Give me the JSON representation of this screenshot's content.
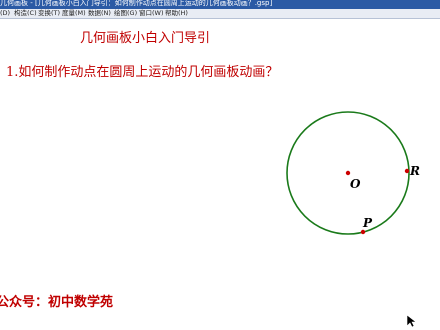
{
  "window": {
    "title": "几何画板 - [几何画板小白入门导引：如何制作动点在圆周上运动的几何画板动画？.gsp]"
  },
  "menu": {
    "items": [
      "(D)",
      "构造(C)",
      "变换(T)",
      "度量(M)",
      "数据(N)",
      "绘图(G)",
      "窗口(W)",
      "帮助(H)"
    ]
  },
  "canvas": {
    "heading": "几何画板小白入门导引",
    "question": "1.如何制作动点在圆周上运动的几何画板动画？",
    "footer": "公众号：初中数学苑"
  },
  "figure": {
    "center_label": "O",
    "point_r_label": "R",
    "point_p_label": "P",
    "circle_color": "#1a7a1a",
    "point_color": "#cc0000"
  },
  "icons": [
    "cursor-arrow-icon"
  ]
}
